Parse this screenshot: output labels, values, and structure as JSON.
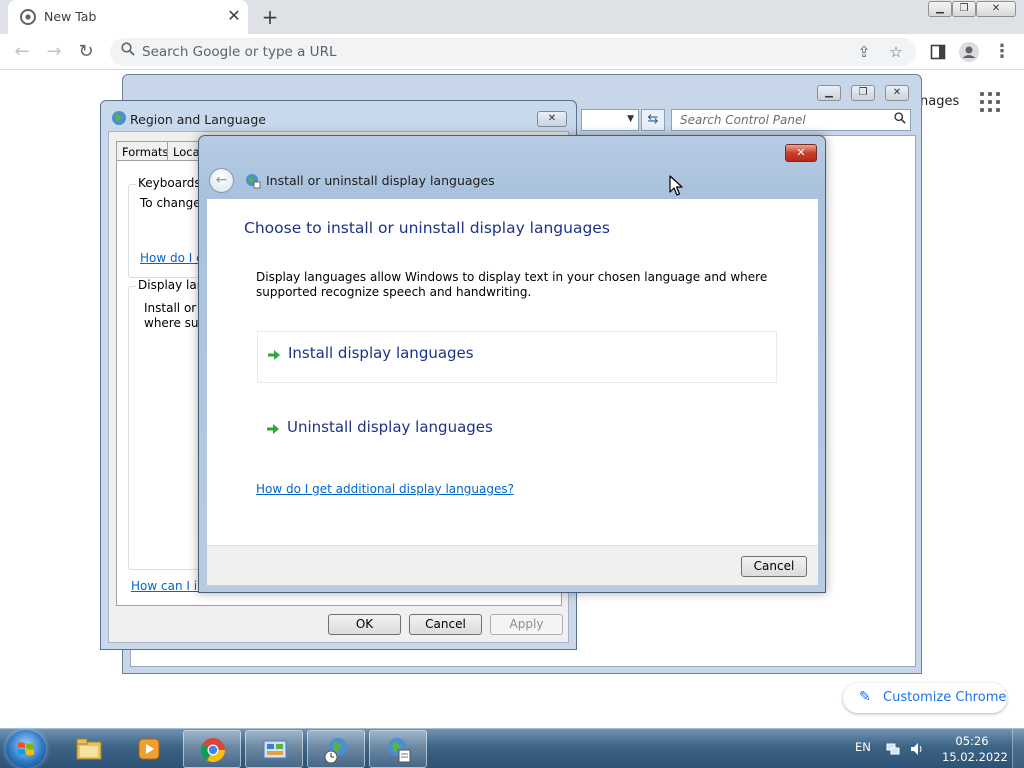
{
  "browser": {
    "tab_title": "New Tab",
    "omnibox_placeholder": "Search Google or type a URL",
    "ntp_partial_text": "nages",
    "customize_label": "Customize Chrome"
  },
  "control_panel": {
    "search_placeholder": "Search Control Panel"
  },
  "region_language": {
    "title": "Region and Language",
    "tabs": [
      "Formats",
      "Locat"
    ],
    "keyboards_group": "Keyboards a",
    "keyboards_text": "To change",
    "keyboards_link": "How do I c",
    "display_group": "Display lang",
    "display_text_1": "Install or u",
    "display_text_2": "where sup",
    "bottom_link": "How can I ins",
    "ok_label": "OK",
    "cancel_label": "Cancel",
    "apply_label": "Apply"
  },
  "display_languages": {
    "title": "Install or uninstall display languages",
    "heading": "Choose to install or uninstall display languages",
    "description": "Display languages allow Windows to display text in your chosen language and where supported recognize speech and handwriting.",
    "options": [
      "Install display languages",
      "Uninstall display languages"
    ],
    "help_link": "How do I get additional display languages?",
    "cancel_label": "Cancel"
  },
  "taskbar": {
    "language": "EN",
    "time": "05:26",
    "date": "15.02.2022"
  },
  "colors": {
    "chrome_accent": "#1a73e8",
    "win7_link": "#0066cc",
    "win7_heading": "#1e3287",
    "close_red": "#c7402a"
  }
}
